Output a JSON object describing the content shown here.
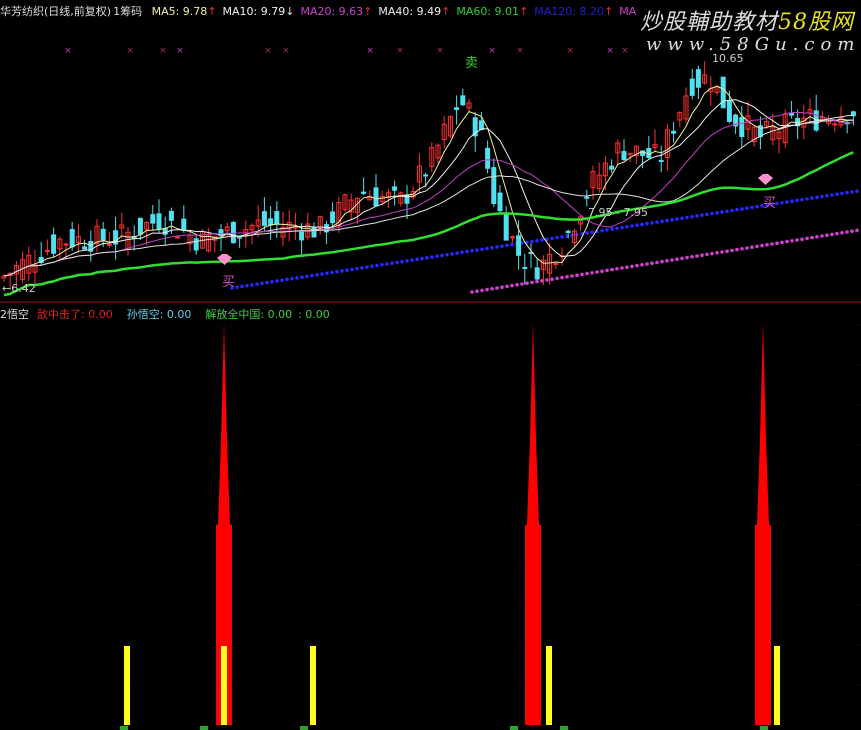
{
  "header": {
    "title": "华芳纺织(日线,前复权)",
    "indicator": "1筹码",
    "ma": [
      {
        "label": "MA5: 9.78",
        "arrow": "↑",
        "color": "#f0f0a0"
      },
      {
        "label": "MA10: 9.79",
        "arrow": "↓",
        "color": "#f0f0f0"
      },
      {
        "label": "MA20: 9.63",
        "arrow": "↑",
        "color": "#d040d0"
      },
      {
        "label": "MA40: 9.49",
        "arrow": "↑",
        "color": "#f0f0f0"
      },
      {
        "label": "MA60: 9.01",
        "arrow": "↑",
        "color": "#30d030"
      },
      {
        "label": "MA120: 8.20",
        "arrow": "↑",
        "color": "#2020d0"
      },
      {
        "label": "MA",
        "arrow": "",
        "color": "#d040d0"
      }
    ]
  },
  "watermark": {
    "line1_a": "炒股輔助教材",
    "line1_b": "58股网",
    "line2": "www.58Gu.com"
  },
  "chart_labels": {
    "high": "10.65",
    "low": "←6.42",
    "mid": "7.95 - 7.95",
    "sell": "卖",
    "buy1": "买",
    "buy2": "买"
  },
  "indicator": {
    "name": "2悟空",
    "items": [
      {
        "label": "敌中击了: 0.00",
        "color": "#e02020"
      },
      {
        "label": "孙悟空: 0.00",
        "color": "#60d0f0"
      },
      {
        "label": "解放全中国: 0.00",
        "color": "#40d040"
      },
      {
        "label": ": 0.00",
        "color": "#40d040"
      }
    ]
  },
  "colors": {
    "up": "#ff3030",
    "down": "#50e0f0",
    "spike": "#ff0000",
    "bar": "#ffff20"
  }
}
